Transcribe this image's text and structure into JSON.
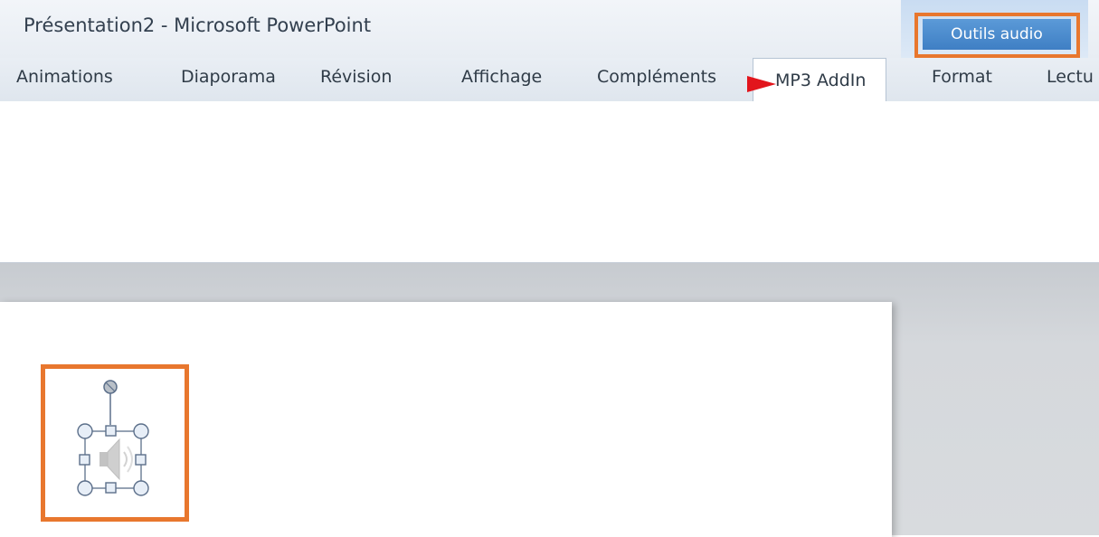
{
  "window": {
    "title": "Présentation2  -  Microsoft PowerPoint",
    "context_tab_group": "Outils audio"
  },
  "tabs": [
    {
      "label": "Animations"
    },
    {
      "label": "Diaporama"
    },
    {
      "label": "Révision"
    },
    {
      "label": "Affichage"
    },
    {
      "label": "Compléments"
    },
    {
      "label": "MP3 AddIn",
      "active": true
    },
    {
      "label": "Format"
    },
    {
      "label": "Lectu"
    }
  ],
  "icons": {
    "pointer_arrow": "red-pointer-icon",
    "audio_object": "speaker-icon"
  },
  "colors": {
    "highlight_orange": "#e8772e",
    "pointer_red": "#e2151c",
    "context_blue": "#4a8bcf"
  }
}
